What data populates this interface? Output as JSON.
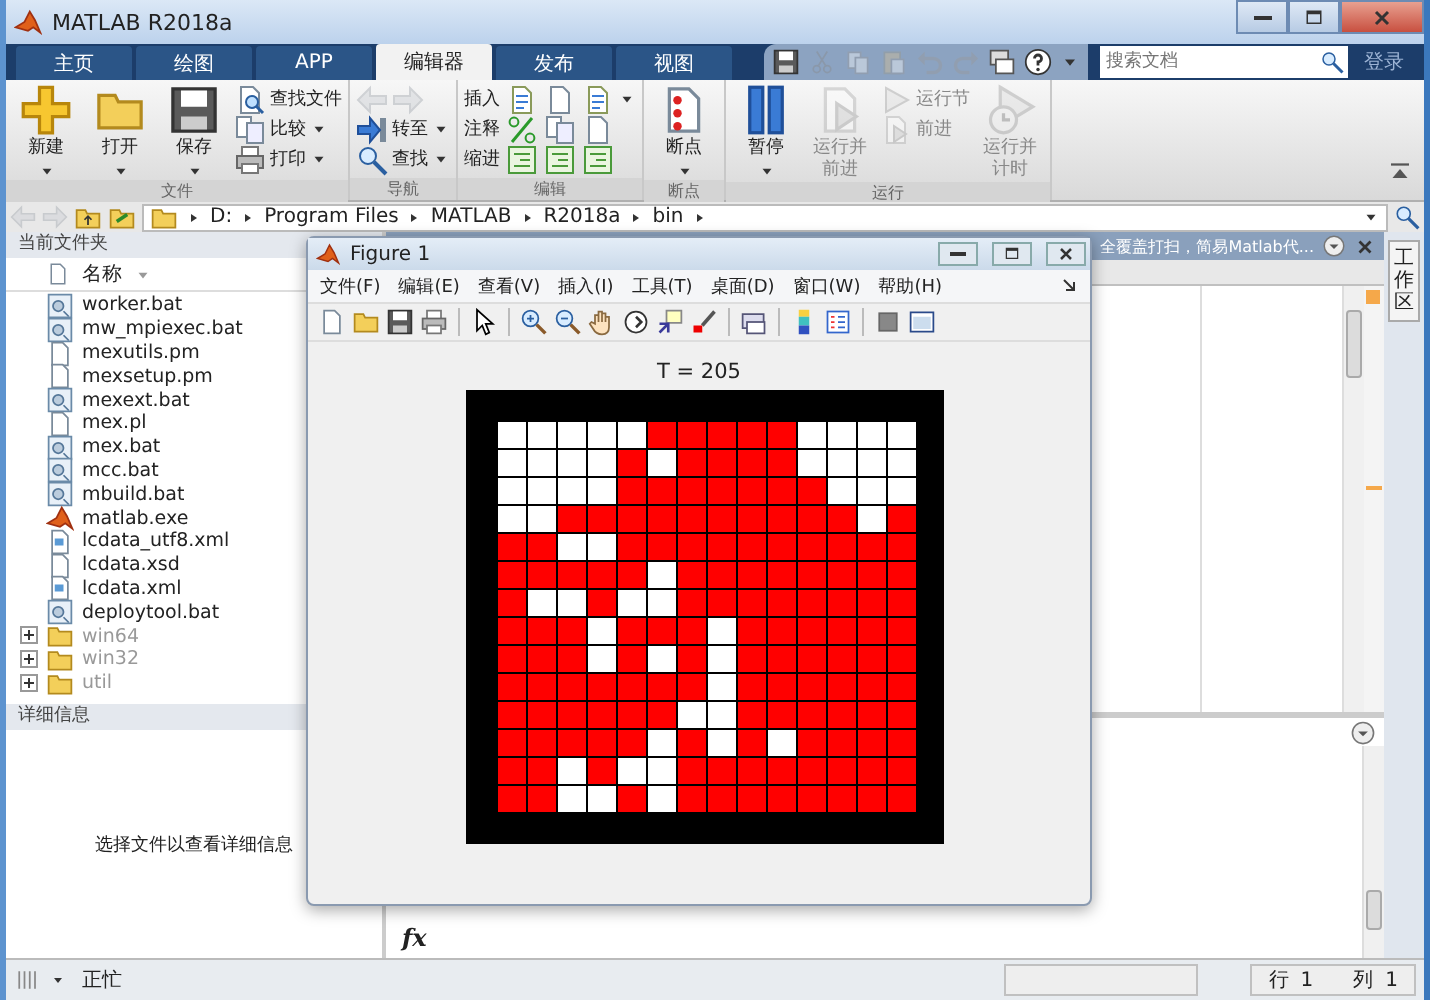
{
  "window": {
    "title": "MATLAB R2018a"
  },
  "ribbon_tabs": [
    {
      "label": "主页",
      "selected": false
    },
    {
      "label": "绘图",
      "selected": false
    },
    {
      "label": "APP",
      "selected": false
    },
    {
      "label": "编辑器",
      "selected": true
    },
    {
      "label": "发布",
      "selected": false
    },
    {
      "label": "视图",
      "selected": false
    }
  ],
  "search": {
    "placeholder": "搜索文档"
  },
  "login": "登录",
  "ribbon_groups": [
    {
      "label": "文件",
      "columns": [
        [
          {
            "kind": "large",
            "label": "新建",
            "dropdown": true,
            "disabled": false
          }
        ],
        [
          {
            "kind": "large",
            "label": "打开",
            "dropdown": true,
            "disabled": false
          }
        ],
        [
          {
            "kind": "large",
            "label": "保存",
            "dropdown": true,
            "disabled": false
          }
        ],
        [
          {
            "kind": "small",
            "label": "查找文件",
            "dropdown": false,
            "disabled": false
          },
          {
            "kind": "small",
            "label": "比较",
            "dropdown": true,
            "disabled": false
          },
          {
            "kind": "small",
            "label": "打印",
            "dropdown": true,
            "disabled": false
          }
        ]
      ]
    },
    {
      "label": "导航",
      "columns": [
        [
          {
            "kind": "arrows",
            "dropdown": false,
            "disabled": true
          },
          {
            "kind": "small",
            "label": "转至",
            "dropdown": true,
            "disabled": false
          },
          {
            "kind": "small",
            "label": "查找",
            "dropdown": true,
            "disabled": false
          }
        ]
      ]
    },
    {
      "label": "编辑",
      "columns": [
        [
          {
            "kind": "text",
            "label": "插入",
            "dropdown": false,
            "disabled": false
          },
          {
            "kind": "text",
            "label": "注释",
            "dropdown": false,
            "disabled": false
          },
          {
            "kind": "text",
            "label": "缩进",
            "dropdown": false,
            "disabled": false
          }
        ],
        [
          {
            "kind": "icon",
            "dropdown": false,
            "disabled": false
          },
          {
            "kind": "icon",
            "dropdown": false,
            "disabled": false
          },
          {
            "kind": "icon",
            "dropdown": false,
            "disabled": false
          }
        ],
        [
          {
            "kind": "icon",
            "dropdown": false,
            "disabled": false
          },
          {
            "kind": "icon",
            "dropdown": false,
            "disabled": false
          },
          {
            "kind": "icon",
            "dropdown": false,
            "disabled": false
          }
        ],
        [
          {
            "kind": "icon",
            "dropdown": true,
            "disabled": false
          },
          {
            "kind": "icon",
            "dropdown": false,
            "disabled": false
          },
          {
            "kind": "icon",
            "dropdown": false,
            "disabled": false
          }
        ]
      ]
    },
    {
      "label": "断点",
      "columns": [
        [
          {
            "kind": "large",
            "label": "断点",
            "dropdown": true,
            "disabled": false
          }
        ]
      ]
    },
    {
      "label": "运行",
      "columns": [
        [
          {
            "kind": "large",
            "label": "暂停",
            "dropdown": true,
            "disabled": false
          }
        ],
        [
          {
            "kind": "large",
            "label": "运行并前进",
            "dropdown": false,
            "disabled": true
          }
        ],
        [
          {
            "kind": "small",
            "label": "运行节",
            "dropdown": false,
            "disabled": true
          },
          {
            "kind": "small",
            "label": "前进",
            "dropdown": false,
            "disabled": true
          }
        ],
        [
          {
            "kind": "large",
            "label": "运行并计时",
            "dropdown": false,
            "disabled": true
          }
        ]
      ]
    }
  ],
  "address_path": [
    "D:",
    "Program Files",
    "MATLAB",
    "R2018a",
    "bin"
  ],
  "current_folder": {
    "title": "当前文件夹",
    "column": "名称",
    "items": [
      {
        "kind": "bat",
        "name": "worker.bat"
      },
      {
        "kind": "bat",
        "name": "mw_mpiexec.bat"
      },
      {
        "kind": "file",
        "name": "mexutils.pm"
      },
      {
        "kind": "file",
        "name": "mexsetup.pm"
      },
      {
        "kind": "bat",
        "name": "mexext.bat"
      },
      {
        "kind": "file",
        "name": "mex.pl"
      },
      {
        "kind": "bat",
        "name": "mex.bat"
      },
      {
        "kind": "bat",
        "name": "mcc.bat"
      },
      {
        "kind": "bat",
        "name": "mbuild.bat"
      },
      {
        "kind": "exe",
        "name": "matlab.exe"
      },
      {
        "kind": "xml",
        "name": "lcdata_utf8.xml"
      },
      {
        "kind": "file",
        "name": "lcdata.xsd"
      },
      {
        "kind": "xml",
        "name": "lcdata.xml"
      },
      {
        "kind": "bat",
        "name": "deploytool.bat"
      },
      {
        "kind": "folder",
        "name": "win64",
        "expanded": false
      },
      {
        "kind": "folder",
        "name": "win32",
        "expanded": false
      },
      {
        "kind": "folder",
        "name": "util",
        "expanded": false
      }
    ]
  },
  "details": {
    "title": "详细信息",
    "message": "选择文件以查看详细信息"
  },
  "editor": {
    "title": "全覆盖打扫，简易Matlab代..."
  },
  "workspace_tab": "工作区",
  "command_window": {
    "prompt": "fx"
  },
  "figure": {
    "title": "Figure 1",
    "menu": [
      "文件(F)",
      "编辑(E)",
      "查看(V)",
      "插入(I)",
      "工具(T)",
      "桌面(D)",
      "窗口(W)",
      "帮助(H)"
    ],
    "axes_title": "T = 205",
    "grid": [
      [
        false,
        false,
        false,
        false,
        false,
        true,
        true,
        true,
        true,
        true,
        false,
        false,
        false,
        false
      ],
      [
        false,
        false,
        false,
        false,
        true,
        false,
        true,
        true,
        true,
        true,
        false,
        false,
        false,
        false
      ],
      [
        false,
        false,
        false,
        false,
        true,
        true,
        true,
        true,
        true,
        true,
        true,
        false,
        false,
        false
      ],
      [
        false,
        false,
        true,
        true,
        true,
        true,
        true,
        true,
        true,
        true,
        true,
        true,
        false,
        true
      ],
      [
        true,
        true,
        false,
        false,
        true,
        true,
        true,
        true,
        true,
        true,
        true,
        true,
        true,
        true
      ],
      [
        true,
        true,
        true,
        true,
        true,
        false,
        true,
        true,
        true,
        true,
        true,
        true,
        true,
        true
      ],
      [
        true,
        false,
        false,
        true,
        false,
        false,
        true,
        true,
        true,
        true,
        true,
        true,
        true,
        true
      ],
      [
        true,
        true,
        true,
        false,
        true,
        true,
        true,
        false,
        true,
        true,
        true,
        true,
        true,
        true
      ],
      [
        true,
        true,
        true,
        false,
        true,
        false,
        true,
        false,
        true,
        true,
        true,
        true,
        true,
        true
      ],
      [
        true,
        true,
        true,
        true,
        true,
        true,
        true,
        false,
        true,
        true,
        true,
        true,
        true,
        true
      ],
      [
        true,
        true,
        true,
        true,
        true,
        true,
        false,
        false,
        true,
        true,
        true,
        true,
        true,
        true
      ],
      [
        true,
        true,
        true,
        true,
        true,
        false,
        true,
        false,
        true,
        false,
        true,
        true,
        true,
        true
      ],
      [
        true,
        true,
        false,
        true,
        false,
        false,
        true,
        true,
        true,
        true,
        true,
        true,
        true,
        true
      ],
      [
        true,
        true,
        false,
        false,
        true,
        false,
        true,
        true,
        true,
        true,
        true,
        true,
        true,
        true
      ]
    ]
  },
  "status_bar": {
    "state": "正忙",
    "row_label": "行",
    "row": "1",
    "col_label": "列",
    "col": "1"
  }
}
